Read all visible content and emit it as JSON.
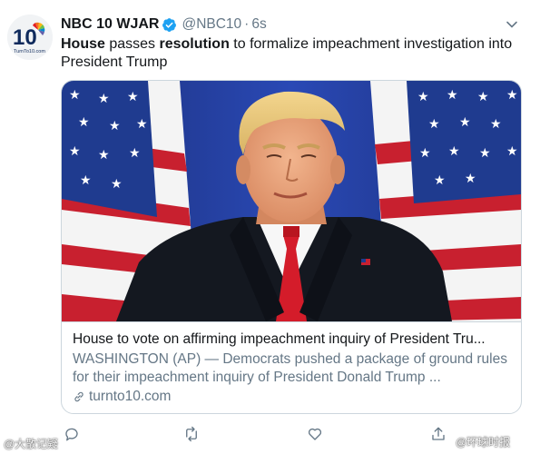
{
  "account": {
    "display_name": "NBC 10 WJAR",
    "handle": "@NBC10",
    "separator": "·",
    "time": "6s",
    "avatar_text_main": "10",
    "avatar_text_sub": "TurnTo10.com"
  },
  "tweet": {
    "parts": [
      {
        "text": "House",
        "bold": true
      },
      {
        "text": " passes ",
        "bold": false
      },
      {
        "text": "resolution",
        "bold": true
      },
      {
        "text": " to formalize impeachment investigation into President Trump",
        "bold": false
      }
    ]
  },
  "card": {
    "title": "House to vote on affirming impeachment inquiry of President Tru...",
    "description": "WASHINGTON (AP) — Democrats pushed a package of ground rules for their impeachment inquiry of President Donald Trump ...",
    "domain": "turnto10.com"
  },
  "actions": {
    "reply_icon": "reply-icon",
    "retweet_icon": "retweet-icon",
    "like_icon": "like-icon",
    "share_icon": "share-icon"
  },
  "watermarks": {
    "left": "@大散记疑",
    "right": "@环球时报"
  },
  "colors": {
    "text": "#14171a",
    "secondary": "#657786",
    "verified": "#1da1f2",
    "border": "#ccd6dd"
  }
}
